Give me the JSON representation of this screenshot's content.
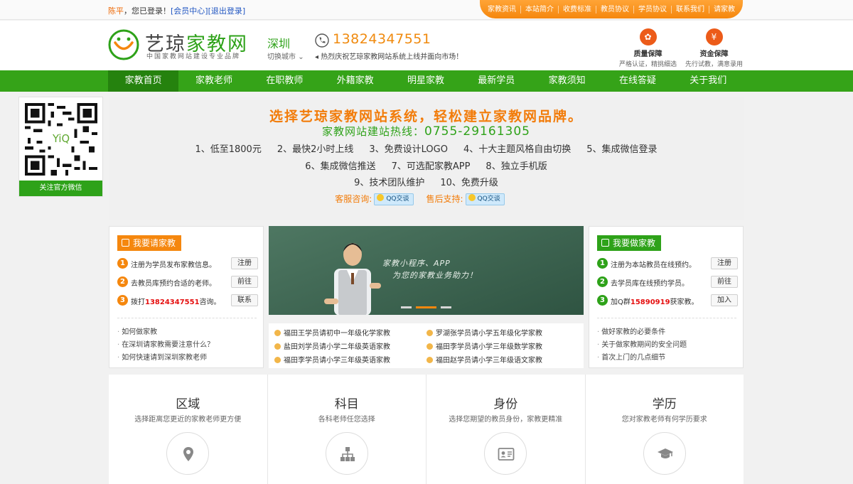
{
  "topbar": {
    "username": "陈平",
    "logged_in_text": "，您已登录！",
    "member_center": "[会员中心]",
    "logout": "[退出登录]",
    "links": [
      "家教资讯",
      "本站简介",
      "收费标准",
      "教员协议",
      "学员协议",
      "联系我们",
      "请家教"
    ]
  },
  "header": {
    "logo_main": "艺琼",
    "logo_accent": "家教网",
    "slogan": "中国家教网站建设专业品牌",
    "city": "深圳",
    "city_switch": "切换城市",
    "phone": "13824347551",
    "notice": "热烈庆祝艺琼家教网站系统上线并面向市场！",
    "guarantees": [
      {
        "title": "质量保障",
        "desc": "严格认证，精挑细选"
      },
      {
        "title": "资金保障",
        "desc": "先行试教，满意录用"
      }
    ]
  },
  "nav": [
    "家教首页",
    "家教老师",
    "在职教师",
    "外籍家教",
    "明星家教",
    "最新学员",
    "家教须知",
    "在线答疑",
    "关于我们"
  ],
  "qr": {
    "label": "关注官方微信"
  },
  "banner": {
    "title": "选择艺琼家教网站系统，轻松建立家教网品牌。",
    "hotline_label": "家教网站建站热线：",
    "hotline": "0755-29161305",
    "features_row1": [
      "1、低至1800元",
      "2、最快2小时上线",
      "3、免费设计LOGO",
      "4、十大主题风格自由切换",
      "5、集成微信登录"
    ],
    "features_row2": [
      "6、集成微信推送",
      "7、可选配家教APP",
      "8、独立手机版"
    ],
    "features_row3": [
      "9、技术团队维护",
      "10、免费升级"
    ],
    "consult_label": "客服咨询:",
    "support_label": "售后支持:",
    "qq_label": "QQ交谈"
  },
  "left_panel": {
    "button": "我要请家教",
    "steps": [
      {
        "num": "1",
        "text": "注册为学员发布家教信息。",
        "action": "注册"
      },
      {
        "num": "2",
        "text": "去教员库预约合适的老师。",
        "action": "前往"
      },
      {
        "num": "3",
        "pre": "拨打",
        "highlight": "13824347551",
        "post": "咨询。",
        "action": "联系"
      }
    ],
    "faqs": [
      "如何做家教",
      "在深圳请家教需要注意什么？",
      "如何快速请到深圳家教老师"
    ]
  },
  "right_panel": {
    "button": "我要做家教",
    "steps": [
      {
        "num": "1",
        "text": "注册为本站教员在线预约。",
        "action": "注册"
      },
      {
        "num": "2",
        "text": "去学员库在线预约学员。",
        "action": "前往"
      },
      {
        "num": "3",
        "pre": "加Q群",
        "highlight": "15890919",
        "post": "获家教。",
        "action": "加入"
      }
    ],
    "faqs": [
      "做好家教的必要条件",
      "关于做家教期间的安全问题",
      "首次上门的几点细节"
    ]
  },
  "slide": {
    "text_line1": "家教小程序、APP",
    "text_line2": "为您的家教业务助力！"
  },
  "news": [
    "福田王学员请初中一年级化学家教",
    "罗湖张学员请小学五年级化学家教",
    "盐田刘学员请小学二年级英语家教",
    "福田李学员请小学三年级数学家教",
    "福田李学员请小学三年级英语家教",
    "福田赵学员请小学三年级语文家教"
  ],
  "categories": [
    {
      "title": "区域",
      "sub": "选择距离您更近的家教老师更方便",
      "icon": "location-icon"
    },
    {
      "title": "科目",
      "sub": "各科老师任您选择",
      "icon": "hierarchy-icon"
    },
    {
      "title": "身份",
      "sub": "选择您期望的教员身份，家教更精准",
      "icon": "id-card-icon"
    },
    {
      "title": "学历",
      "sub": "您对家教老师有何学历要求",
      "icon": "graduation-cap-icon"
    }
  ],
  "colors": {
    "green": "#35a318",
    "orange": "#f5870e",
    "dark_green": "#25820e"
  }
}
